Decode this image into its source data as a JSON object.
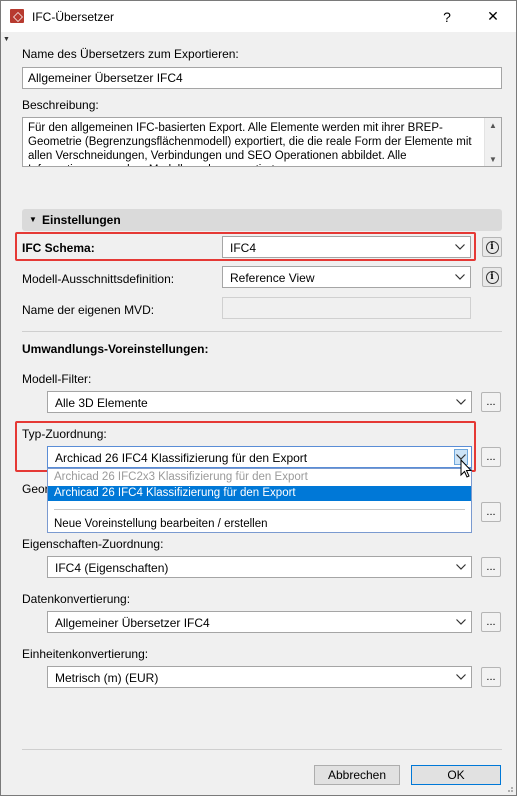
{
  "window": {
    "title": "IFC-Übersetzer",
    "help_symbol": "?",
    "close_symbol": "✕"
  },
  "export_name": {
    "label": "Name des Übersetzers zum Exportieren:",
    "value": "Allgemeiner Übersetzer IFC4"
  },
  "description": {
    "label": "Beschreibung:",
    "text": "Für den allgemeinen IFC-basierten Export. Alle Elemente werden mit ihrer BREP-Geometrie (Begrenzungsflächenmodell) exportiert, die die reale Form der Elemente mit allen Verschneidungen, Verbindungen und SEO Operationen abbildet. Alle Informationen aus dem Modell werden exportiert."
  },
  "settings_section": {
    "label": "Einstellungen"
  },
  "ifc_schema": {
    "label": "IFC Schema:",
    "value": "IFC4"
  },
  "mvd": {
    "label": "Modell-Ausschnittsdefinition:",
    "value": "Reference View"
  },
  "custom_mvd": {
    "label": "Name der eigenen MVD:",
    "value": ""
  },
  "conversion_presets": {
    "heading": "Umwandlungs-Voreinstellungen:"
  },
  "model_filter": {
    "label": "Modell-Filter:",
    "value": "Alle 3D Elemente",
    "more": "..."
  },
  "type_mapping": {
    "label": "Typ-Zuordnung:",
    "value": "Archicad 26 IFC4 Klassifizierung für den Export",
    "more": "...",
    "options": [
      "Archicad 26 IFC2x3 Klassifizierung für den Export",
      "Archicad 26 IFC4 Klassifizierung für den Export",
      "Neue Voreinstellung bearbeiten / erstellen"
    ]
  },
  "geometry": {
    "label_partial": "Geor",
    "more": "..."
  },
  "property_mapping": {
    "label": "Eigenschaften-Zuordnung:",
    "value": "IFC4 (Eigenschaften)",
    "more": "..."
  },
  "data_conversion": {
    "label": "Datenkonvertierung:",
    "value": "Allgemeiner Übersetzer IFC4",
    "more": "..."
  },
  "unit_conversion": {
    "label": "Einheitenkonvertierung:",
    "value": "Metrisch (m) (EUR)",
    "more": "..."
  },
  "footer": {
    "cancel_label": "Abbrechen",
    "ok_label": "OK"
  },
  "colors": {
    "highlight": "#e53935",
    "selection": "#0078d7"
  }
}
